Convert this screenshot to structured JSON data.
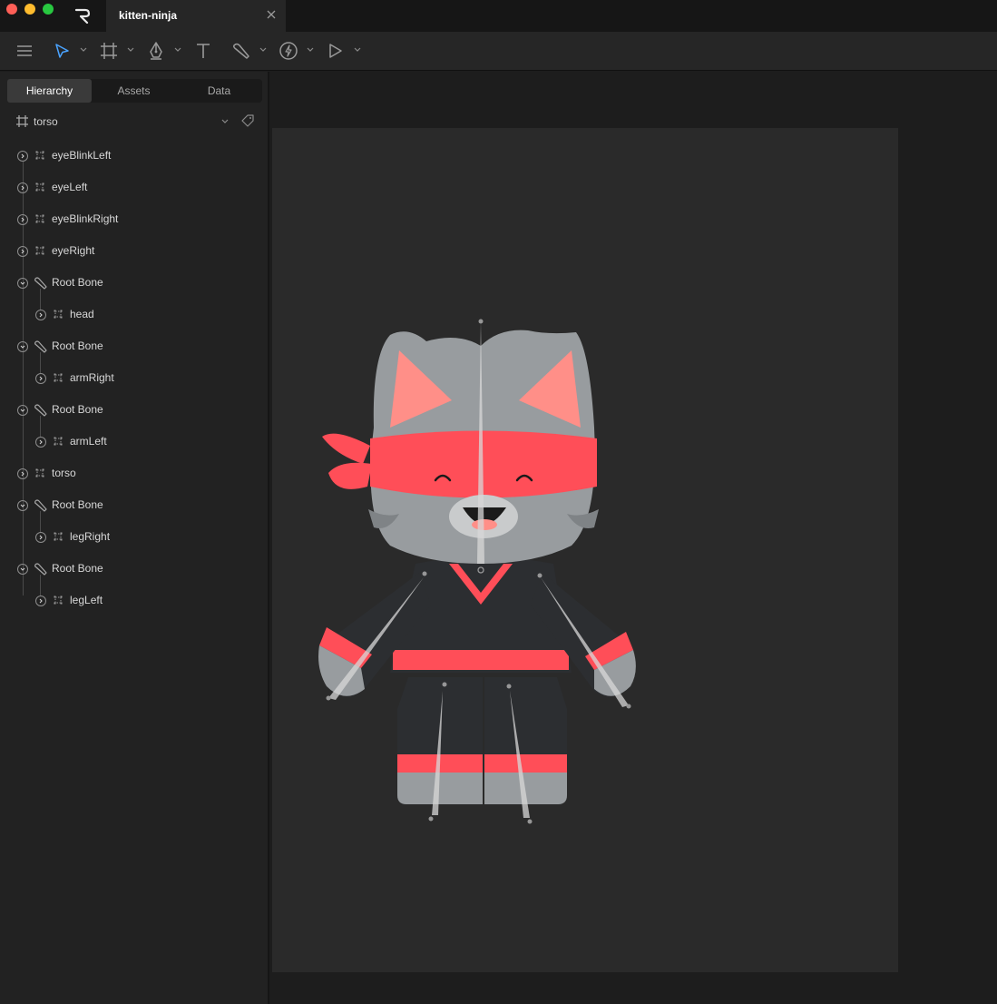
{
  "window": {
    "tab_title": "kitten-ninja"
  },
  "toolbar": {
    "tools": [
      {
        "icon": "menu-icon"
      },
      {
        "icon": "select-arrow-icon",
        "active": true
      },
      {
        "icon": "artboard-frame-icon"
      },
      {
        "icon": "pen-icon"
      },
      {
        "icon": "text-icon"
      },
      {
        "icon": "bone-icon"
      },
      {
        "icon": "lightning-icon"
      },
      {
        "icon": "play-icon"
      }
    ]
  },
  "sidebar": {
    "tabs": [
      "Hierarchy",
      "Assets",
      "Data"
    ],
    "active_tab": "Hierarchy",
    "artboard_name": "torso",
    "items": [
      {
        "label": "eyeBlinkLeft",
        "type": "shape",
        "depth": 0
      },
      {
        "label": "eyeLeft",
        "type": "shape",
        "depth": 0
      },
      {
        "label": "eyeBlinkRight",
        "type": "shape",
        "depth": 0
      },
      {
        "label": "eyeRight",
        "type": "shape",
        "depth": 0
      },
      {
        "label": "Root Bone",
        "type": "bone",
        "depth": 0,
        "expanded": true
      },
      {
        "label": "head",
        "type": "shape",
        "depth": 1
      },
      {
        "label": "Root Bone",
        "type": "bone",
        "depth": 0,
        "expanded": true
      },
      {
        "label": "armRight",
        "type": "shape",
        "depth": 1
      },
      {
        "label": "Root Bone",
        "type": "bone",
        "depth": 0,
        "expanded": true
      },
      {
        "label": "armLeft",
        "type": "shape",
        "depth": 1
      },
      {
        "label": "torso",
        "type": "shape",
        "depth": 0
      },
      {
        "label": "Root Bone",
        "type": "bone",
        "depth": 0,
        "expanded": true
      },
      {
        "label": "legRight",
        "type": "shape",
        "depth": 1
      },
      {
        "label": "Root Bone",
        "type": "bone",
        "depth": 0,
        "expanded": true
      },
      {
        "label": "legLeft",
        "type": "shape",
        "depth": 1
      }
    ]
  },
  "colors": {
    "accent": "#4aa3ff",
    "ninja_red": "#ff4e58",
    "fur_gray": "#989c9f",
    "suit_dark": "#2c2e31",
    "ear_pink": "#ff8f88"
  }
}
